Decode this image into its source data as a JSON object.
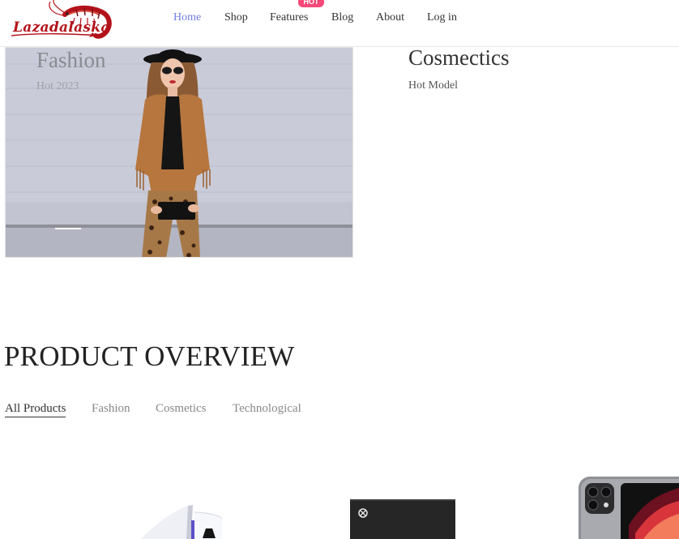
{
  "header": {
    "logo_text": "Lazadalaska",
    "nav": [
      {
        "label": "Home",
        "active": true
      },
      {
        "label": "Shop",
        "active": false
      },
      {
        "label": "Features",
        "active": false
      },
      {
        "label": "Blog",
        "active": false
      },
      {
        "label": "About",
        "active": false
      },
      {
        "label": "Log in",
        "active": false
      }
    ],
    "hot_badge": "HOT"
  },
  "banners": [
    {
      "title": "Fashion",
      "subtitle": "Hot 2023"
    },
    {
      "title": "Cosmectics",
      "subtitle": "Hot Model"
    }
  ],
  "overview": {
    "title": "PRODUCT OVERVIEW",
    "filters": [
      {
        "label": "All Products",
        "active": true
      },
      {
        "label": "Fashion",
        "active": false
      },
      {
        "label": "Cosmetics",
        "active": false
      },
      {
        "label": "Technological",
        "active": false
      }
    ]
  },
  "colors": {
    "accent": "#717fe0",
    "hot": "#f74877",
    "logo": "#b3121a"
  }
}
